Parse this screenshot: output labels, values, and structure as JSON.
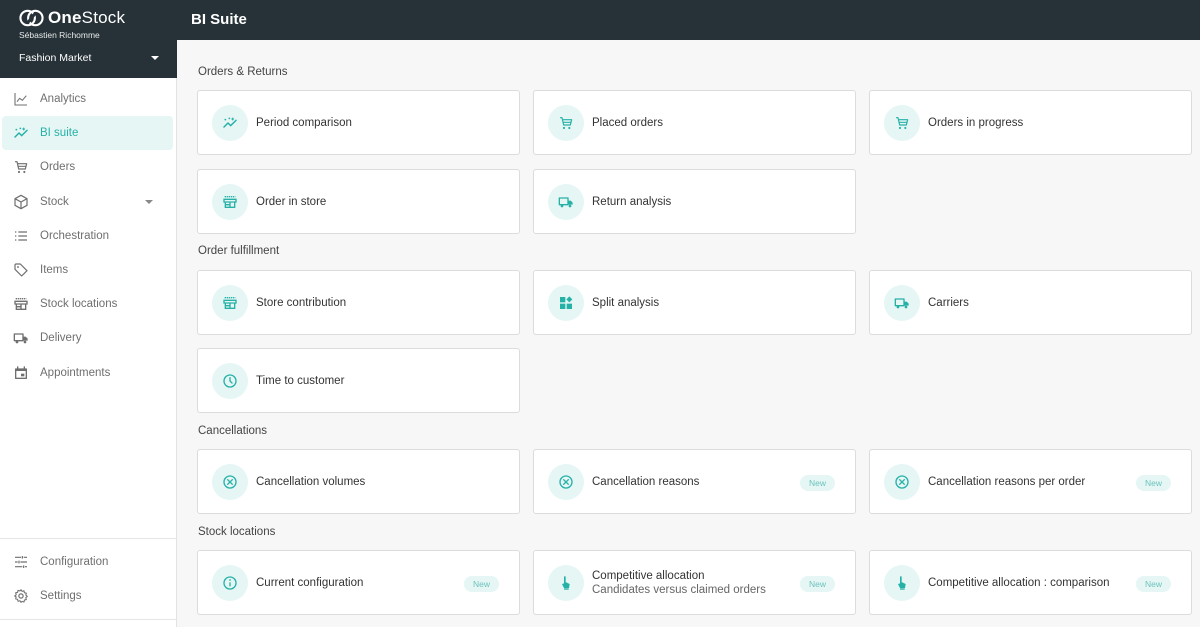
{
  "app": {
    "brand": "OneStock",
    "brand_bold": "One",
    "brand_rest": "Stock",
    "user": "Sébastien Richomme",
    "organization": "Fashion Market",
    "page_title": "BI Suite",
    "accent_color": "#26b1a7"
  },
  "sidebar": {
    "items": [
      {
        "label": "Analytics",
        "icon": "chart-line-icon"
      },
      {
        "label": "BI suite",
        "icon": "trend-icon",
        "active": true
      },
      {
        "label": "Orders",
        "icon": "cart-icon"
      },
      {
        "label": "Stock",
        "icon": "cube-icon",
        "has_submenu": true
      },
      {
        "label": "Orchestration",
        "icon": "list-icon"
      },
      {
        "label": "Items",
        "icon": "tag-icon"
      },
      {
        "label": "Stock locations",
        "icon": "store-icon"
      },
      {
        "label": "Delivery",
        "icon": "truck-icon"
      },
      {
        "label": "Appointments",
        "icon": "calendar-icon"
      }
    ],
    "bottom_items": [
      {
        "label": "Configuration",
        "icon": "sliders-icon"
      },
      {
        "label": "Settings",
        "icon": "gear-icon"
      }
    ]
  },
  "sections": [
    {
      "title": "Orders & Returns",
      "cards": [
        {
          "label": "Period comparison",
          "icon": "trend-icon"
        },
        {
          "label": "Placed orders",
          "icon": "cart-icon"
        },
        {
          "label": "Orders in progress",
          "icon": "cart-icon"
        },
        {
          "label": "Order in store",
          "icon": "store-icon"
        },
        {
          "label": "Return analysis",
          "icon": "truck-icon"
        }
      ]
    },
    {
      "title": "Order fulfillment",
      "cards": [
        {
          "label": "Store contribution",
          "icon": "store-icon"
        },
        {
          "label": "Split analysis",
          "icon": "widgets-icon"
        },
        {
          "label": "Carriers",
          "icon": "truck-icon"
        },
        {
          "label": "Time to customer",
          "icon": "clock-icon"
        }
      ]
    },
    {
      "title": "Cancellations",
      "cards": [
        {
          "label": "Cancellation volumes",
          "icon": "cancel-circle-icon"
        },
        {
          "label": "Cancellation reasons",
          "icon": "cancel-circle-icon",
          "badge": "New"
        },
        {
          "label": "Cancellation reasons per order",
          "icon": "cancel-circle-icon",
          "badge": "New"
        }
      ]
    },
    {
      "title": "Stock locations",
      "cards": [
        {
          "label": "Current configuration",
          "icon": "info-icon",
          "badge": "New"
        },
        {
          "label": "Competitive allocation",
          "sublabel": "Candidates versus claimed orders",
          "icon": "hand-pointer-icon",
          "badge": "New"
        },
        {
          "label": "Competitive allocation : comparison",
          "icon": "hand-pointer-icon",
          "badge": "New"
        }
      ]
    }
  ]
}
